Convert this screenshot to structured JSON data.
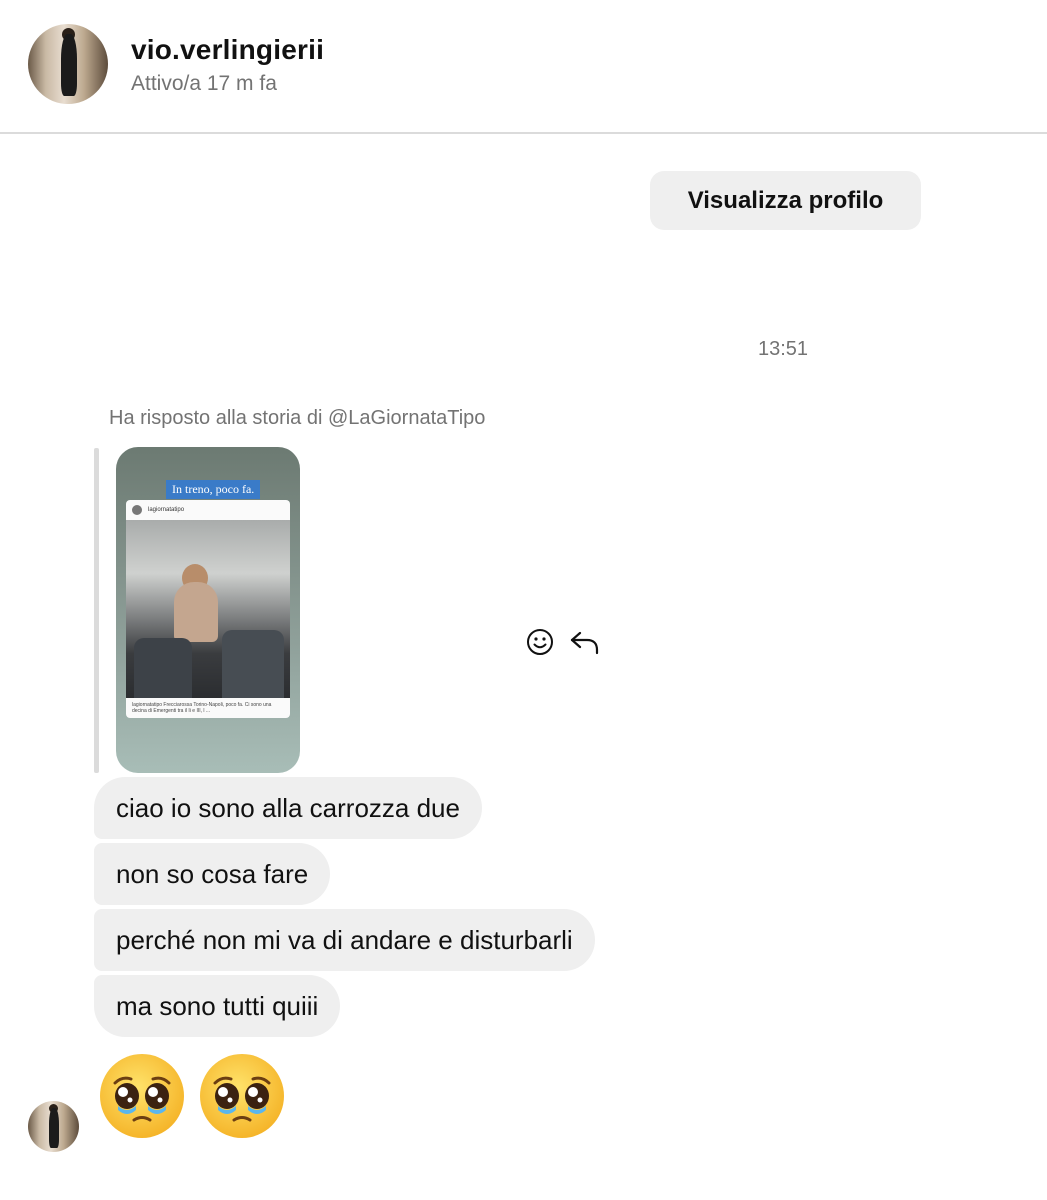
{
  "header": {
    "username": "vio.verlingierii",
    "status": "Attivo/a 17 m fa",
    "avatar_icon": "user-avatar"
  },
  "actions": {
    "view_profile_label": "Visualizza profilo"
  },
  "thread": {
    "timestamp": "13:51",
    "story_reply_note": "Ha risposto alla storia di @LaGiornataTipo",
    "story": {
      "overlay_text": "In treno, poco fa.",
      "card_account": "lagiornatatipo",
      "card_caption": "lagiornatatipo Frecciarossa Torino-Napoli, poco fa. Ci sono una decina di Emergenti tra il Ii e III, l ..."
    },
    "messages": [
      {
        "text": "ciao io sono alla carrozza due"
      },
      {
        "text": "non so cosa fare"
      },
      {
        "text": "perché non mi va di andare e disturbarli"
      },
      {
        "text": "ma sono tutti quiii"
      }
    ],
    "emoji_message": {
      "emojis": [
        "🥹",
        "🥹"
      ]
    },
    "hover_icons": [
      "smiley-react-icon",
      "reply-arrow-icon"
    ]
  },
  "colors": {
    "bubble": "#efefef",
    "muted_text": "#737373",
    "divider": "#dbdbdb"
  }
}
